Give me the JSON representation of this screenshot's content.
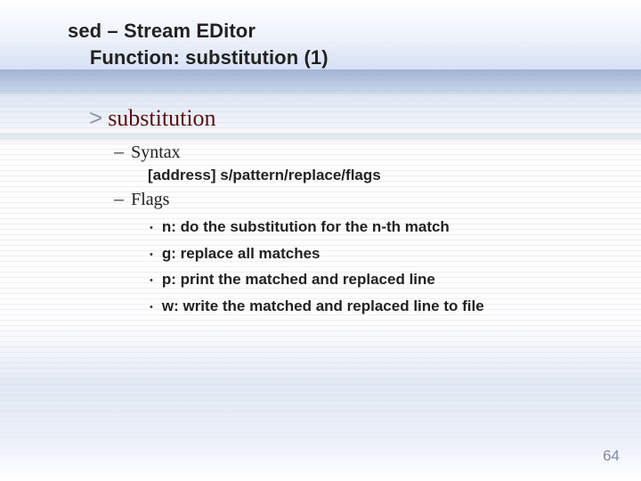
{
  "title": {
    "line1": "sed – Stream EDitor",
    "line2": "Function: substitution (1)"
  },
  "section": {
    "heading": "substitution",
    "syntax_label": "Syntax",
    "syntax_text": "[address] s/pattern/replace/flags",
    "flags_label": "Flags",
    "flags": [
      "n: do the substitution for the n-th match",
      "g: replace all matches",
      "p: print the matched and replaced line",
      "w: write the matched and replaced line to file"
    ]
  },
  "page_number": "64"
}
